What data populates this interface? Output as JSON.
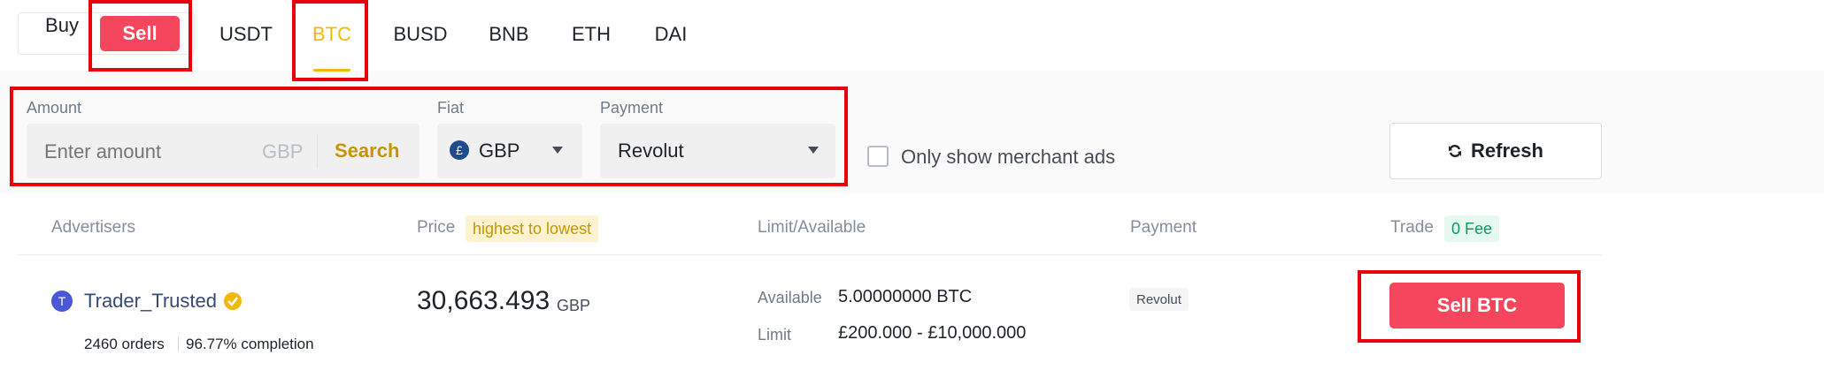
{
  "trade_type": {
    "buy_label": "Buy",
    "sell_label": "Sell",
    "selected": "Sell"
  },
  "assets": {
    "tabs": [
      {
        "label": "USDT"
      },
      {
        "label": "BTC"
      },
      {
        "label": "BUSD"
      },
      {
        "label": "BNB"
      },
      {
        "label": "ETH"
      },
      {
        "label": "DAI"
      }
    ],
    "selected": "BTC"
  },
  "filters": {
    "amount": {
      "label": "Amount",
      "placeholder": "Enter amount",
      "currency": "GBP",
      "search_label": "Search"
    },
    "fiat": {
      "label": "Fiat",
      "symbol": "£",
      "value": "GBP"
    },
    "payment": {
      "label": "Payment",
      "value": "Revolut"
    },
    "merchant_only_label": "Only show merchant ads",
    "refresh_label": "Refresh"
  },
  "table": {
    "headers": {
      "advertisers": "Advertisers",
      "price": "Price",
      "price_sort": "highest to lowest",
      "limit": "Limit/Available",
      "payment": "Payment",
      "trade": "Trade",
      "fee_badge": "0 Fee"
    },
    "rows": [
      {
        "avatar_letter": "T",
        "name": "Trader_Trusted",
        "orders": "2460 orders",
        "completion": "96.77% completion",
        "price": "30,663.493",
        "price_currency": "GBP",
        "available_label": "Available",
        "available_value": "5.00000000 BTC",
        "limit_label": "Limit",
        "limit_value": "£200.000 - £10,000.000",
        "payment_method": "Revolut",
        "action_label": "Sell BTC"
      }
    ]
  },
  "colors": {
    "sell_red": "#f6465d",
    "accent_yellow": "#f0b90b",
    "highlight_box": "#e8000b",
    "fiat_badge": "#1e4a8f",
    "avatar": "#4a57d6",
    "verified_badge": "#f0b90b",
    "fee_badge_green": "#02a05b"
  }
}
